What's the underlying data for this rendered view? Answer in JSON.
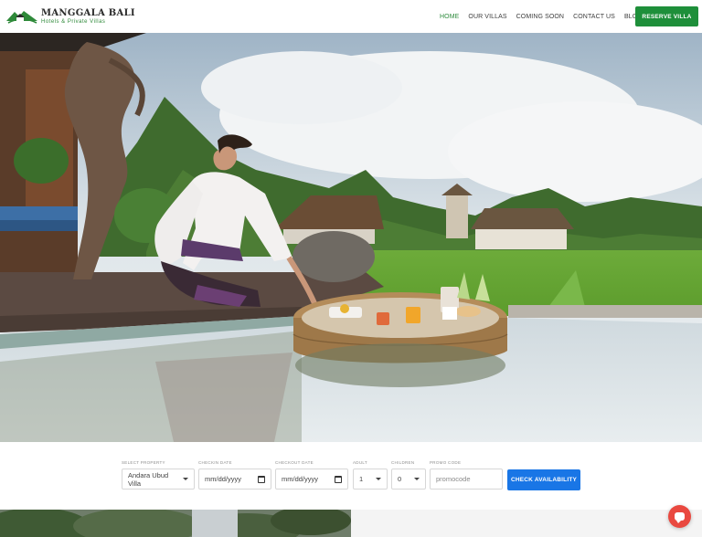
{
  "brand": {
    "name": "MANGGALA BALI",
    "tagline": "Hotels & Private Villas",
    "accent_color": "#1e8f3a"
  },
  "nav": {
    "items": [
      {
        "label": "HOME",
        "active": true
      },
      {
        "label": "OUR VILLAS",
        "active": false
      },
      {
        "label": "COMING SOON",
        "active": false
      },
      {
        "label": "CONTACT US",
        "active": false
      },
      {
        "label": "BLOG",
        "active": false
      }
    ],
    "reserve_label": "RESERVE VILLA"
  },
  "booking": {
    "property": {
      "label": "SELECT PROPERTY",
      "value": "Andara Ubud Villa"
    },
    "checkin": {
      "label": "CHECKIN DATE",
      "value": "mm/dd/yyyy"
    },
    "checkout": {
      "label": "CHECKOUT DATE",
      "value": "mm/dd/yyyy"
    },
    "adult": {
      "label": "ADULT",
      "value": "1"
    },
    "children": {
      "label": "CHILDREN",
      "value": "0"
    },
    "promo": {
      "label": "PROMO CODE",
      "placeholder": "promocode"
    },
    "submit_label": "CHECK AVAILABILITY",
    "submit_color": "#1976e6"
  },
  "icons": {
    "logo": "mountain-house-logo-icon",
    "calendar": "calendar-icon",
    "caret": "chevron-down-icon",
    "chat": "chat-bubble-icon"
  },
  "chat_color": "#e9483f"
}
